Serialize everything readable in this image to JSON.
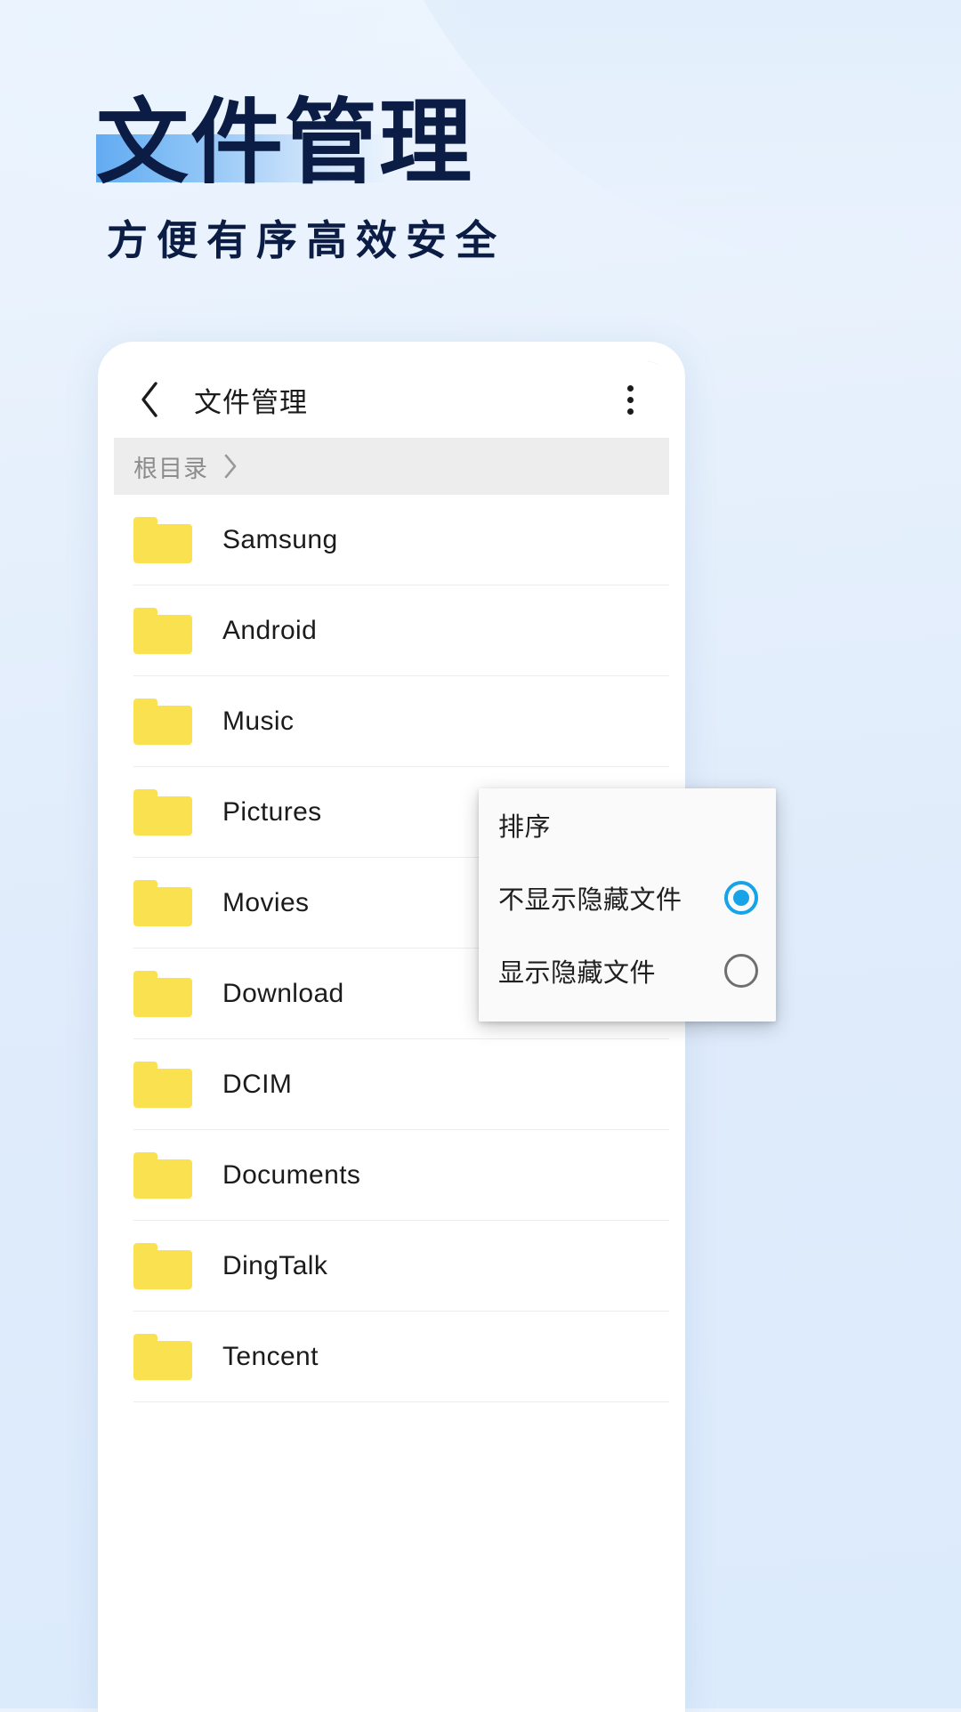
{
  "hero": {
    "title": "文件管理",
    "subtitle": "方便有序高效安全",
    "title_color": "#0b1c45",
    "highlight_color": "#62abf2"
  },
  "appbar": {
    "back_icon": "chevron-left-icon",
    "title": "文件管理",
    "overflow_icon": "more-vertical-icon"
  },
  "breadcrumb": {
    "label": "根目录",
    "separator_icon": "chevron-right-icon"
  },
  "file_list": {
    "items": [
      {
        "name": "Samsung",
        "icon": "folder-icon"
      },
      {
        "name": "Android",
        "icon": "folder-icon"
      },
      {
        "name": "Music",
        "icon": "folder-icon"
      },
      {
        "name": "Pictures",
        "icon": "folder-icon"
      },
      {
        "name": "Movies",
        "icon": "folder-icon"
      },
      {
        "name": "Download",
        "icon": "folder-icon"
      },
      {
        "name": "DCIM",
        "icon": "folder-icon"
      },
      {
        "name": "Documents",
        "icon": "folder-icon"
      },
      {
        "name": "DingTalk",
        "icon": "folder-icon"
      },
      {
        "name": "Tencent",
        "icon": "folder-icon"
      }
    ],
    "folder_color": "#fae14f"
  },
  "menu": {
    "items": [
      {
        "label": "排序",
        "radio": "none",
        "selected": false
      },
      {
        "label": "不显示隐藏文件",
        "radio": "on",
        "selected": true
      },
      {
        "label": "显示隐藏文件",
        "radio": "off",
        "selected": false
      }
    ],
    "accent_color": "#17a3e8",
    "inactive_color": "#6f6f6f"
  }
}
